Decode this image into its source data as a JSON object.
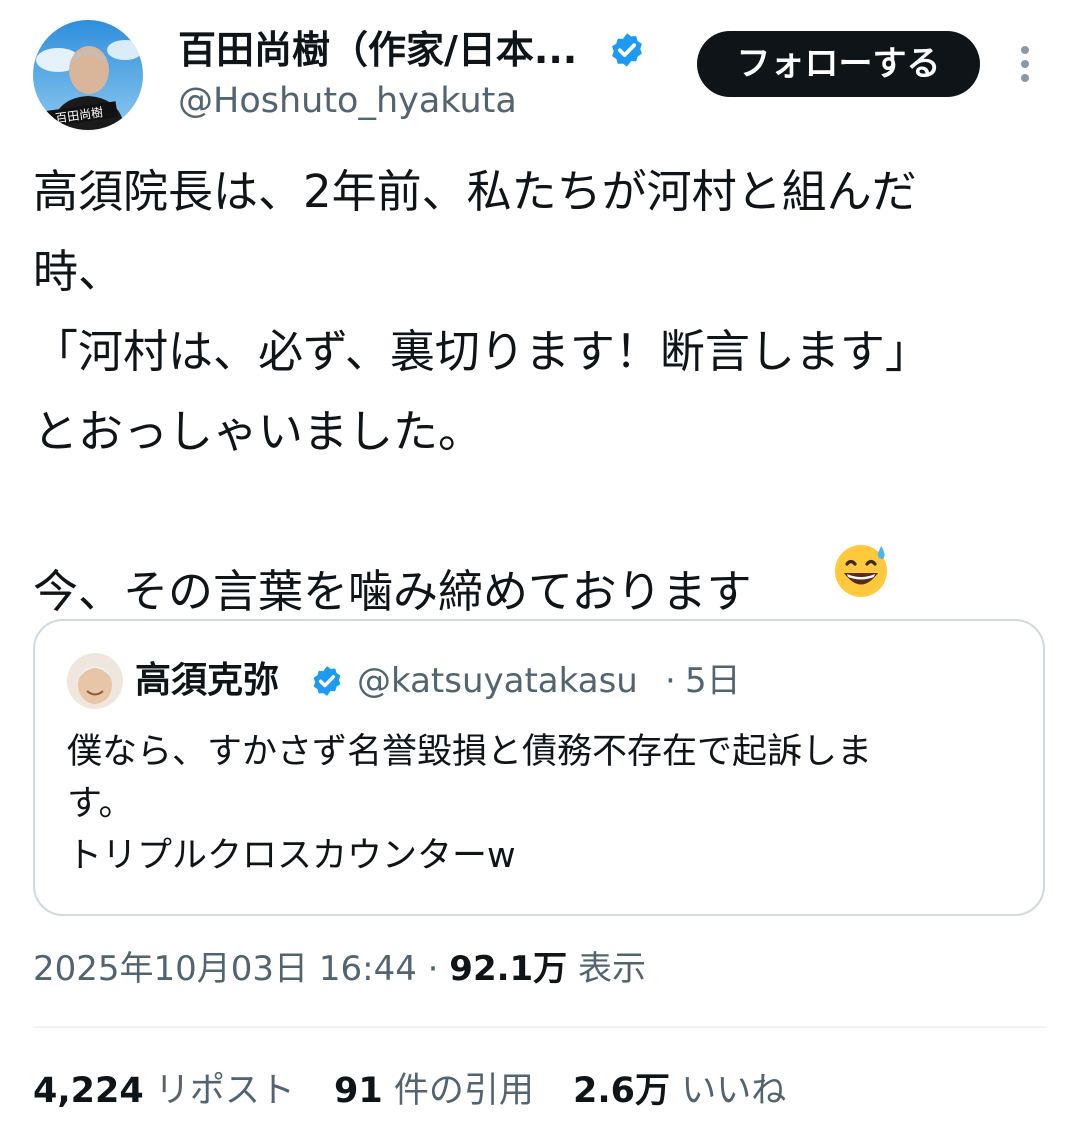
{
  "author": {
    "name": "百田尚樹（作家/日本...",
    "handle": "@Hoshuto_hyakuta",
    "avatar_text": "百田尚樹",
    "verified_color": "#1d9bf0"
  },
  "header": {
    "follow_label": "フォローする"
  },
  "tweet": {
    "text": "高須院長は、2年前、私たちが河村と組んだ\n時、\n「河村は、必ず、裏切ります！断言します」\nとおっしゃいました。\n\n今、その言葉を噛み締めております",
    "emoji": "grinning-face-with-sweat"
  },
  "quote": {
    "name": "高須克弥",
    "handle": "@katsuyatakasu",
    "separator": "·",
    "time": "5日",
    "text": "僕なら、すかさず名誉毀損と債務不存在で起訴しま\nす。\nトリプルクロスカウンターw"
  },
  "meta": {
    "timestamp": "2025年10月03日 16:44",
    "separator": "·",
    "views_count": "92.1万",
    "views_label": "表示"
  },
  "stats": {
    "reposts_count": "4,224",
    "reposts_label": "リポスト",
    "quotes_count": "91",
    "quotes_label": "件の引用",
    "likes_count": "2.6万",
    "likes_label": "いいね"
  },
  "colors": {
    "text": "#0f1419",
    "secondary": "#536471",
    "verified": "#1d9bf0",
    "follow_bg": "#0f1419"
  }
}
